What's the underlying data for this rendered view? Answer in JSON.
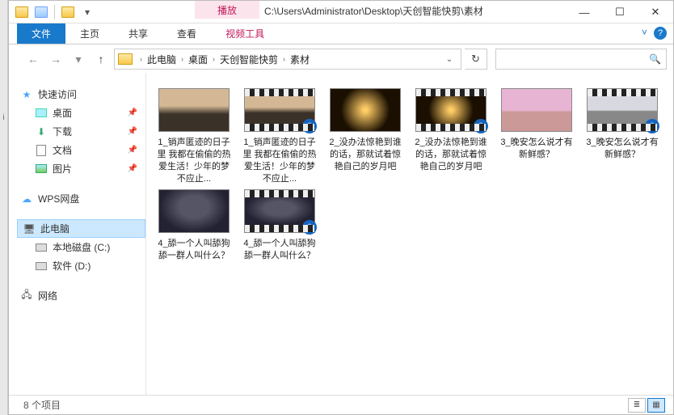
{
  "title_path": "C:\\Users\\Administrator\\Desktop\\天创智能快剪\\素材",
  "play_tab": "播放",
  "ribbon": {
    "file": "文件",
    "home": "主页",
    "share": "共享",
    "view": "查看",
    "video_tools": "视频工具"
  },
  "breadcrumbs": [
    "此电脑",
    "桌面",
    "天创智能快剪",
    "素材"
  ],
  "nav": {
    "quick_access": "快速访问",
    "desktop": "桌面",
    "downloads": "下载",
    "documents": "文档",
    "pictures": "图片",
    "wps": "WPS网盘",
    "this_pc": "此电脑",
    "disk_c": "本地磁盘 (C:)",
    "disk_d": "软件 (D:)",
    "network": "网络"
  },
  "items": [
    {
      "name": "1_销声匿迹的日子里 我都在偷偷的热爱生活！少年的梦不应止...",
      "video": false,
      "thumb": "t1"
    },
    {
      "name": "1_销声匿迹的日子里 我都在偷偷的热爱生活！少年的梦不应止...",
      "video": true,
      "thumb": "t1"
    },
    {
      "name": "2_没办法惊艳到谁的话，那就试着惊艳自己的岁月吧",
      "video": false,
      "thumb": "t2"
    },
    {
      "name": "2_没办法惊艳到谁的话，那就试着惊艳自己的岁月吧",
      "video": true,
      "thumb": "t2"
    },
    {
      "name": "3_晚安怎么说才有新鲜感？",
      "video": false,
      "thumb": "t3"
    },
    {
      "name": "3_晚安怎么说才有新鲜感？",
      "video": true,
      "thumb": "t4"
    },
    {
      "name": "4_舔一个人叫舔狗    舔一群人叫什么？",
      "video": false,
      "thumb": "t5"
    },
    {
      "name": "4_舔一个人叫舔狗    舔一群人叫什么？",
      "video": true,
      "thumb": "t5"
    }
  ],
  "status": "8 个项目"
}
